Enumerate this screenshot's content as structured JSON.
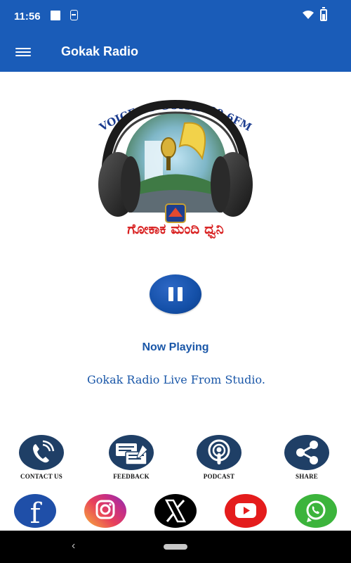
{
  "status_bar": {
    "time": "11:56",
    "icons": [
      "square-notification-icon",
      "sim-icon",
      "wifi-icon",
      "battery-icon"
    ]
  },
  "app_bar": {
    "title": "Gokak Radio",
    "menu_icon": "hamburger-menu-icon"
  },
  "logo": {
    "arc_text": "VOICE OF GOKAK 89.6FM",
    "bottom_text": "ಗೋಕಾಕ ಮಂದಿ ಧ್ವನಿ",
    "icon": "headphones-logo"
  },
  "player": {
    "state_icon": "pause-icon",
    "status": "Now Playing",
    "track": "Gokak Radio Live From Studio."
  },
  "actions": [
    {
      "label": "CONTACT US",
      "icon": "phone-icon"
    },
    {
      "label": "FEEDBACK",
      "icon": "feedback-icon"
    },
    {
      "label": "PODCAST",
      "icon": "podcast-icon"
    },
    {
      "label": "SHARE",
      "icon": "share-icon"
    }
  ],
  "social": [
    {
      "name": "facebook",
      "icon": "facebook-icon",
      "color": "#1f4fa8"
    },
    {
      "name": "instagram",
      "icon": "instagram-icon",
      "color": "#d6307d"
    },
    {
      "name": "x",
      "icon": "x-icon",
      "color": "#000000"
    },
    {
      "name": "youtube",
      "icon": "youtube-icon",
      "color": "#e41c1c"
    },
    {
      "name": "whatsapp",
      "icon": "whatsapp-icon",
      "color": "#3cb43c"
    }
  ],
  "colors": {
    "primary": "#1a5cb8",
    "action_circle": "#1f3f66",
    "text_blue": "#1a57a8"
  },
  "nav_bar": {
    "back_icon": "back-icon",
    "home_icon": "home-pill-icon"
  }
}
